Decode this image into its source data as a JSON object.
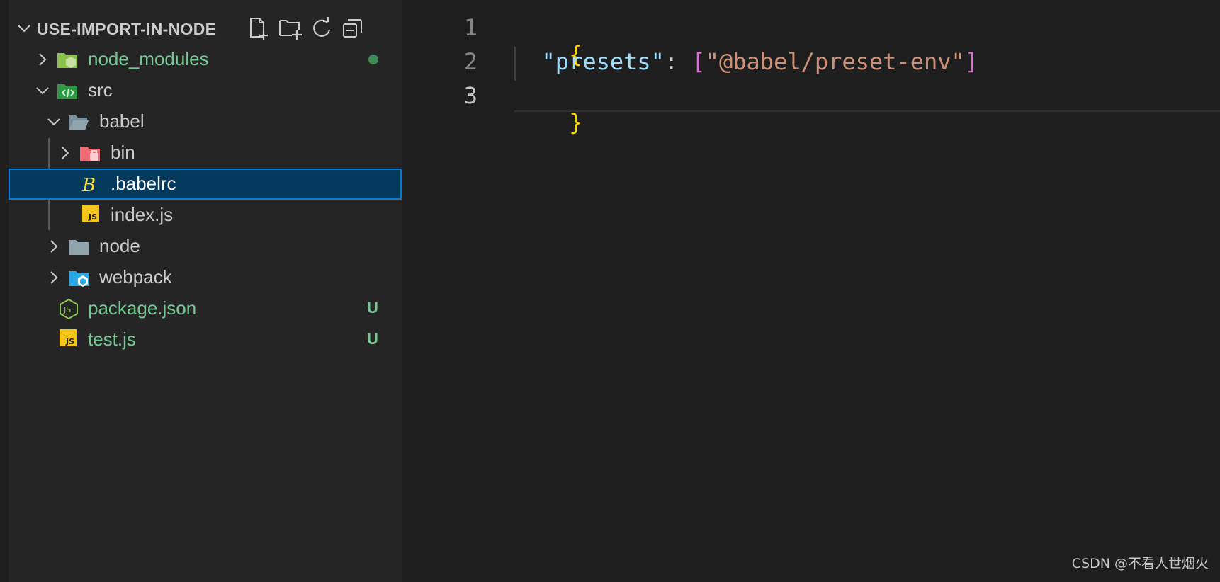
{
  "explorer": {
    "title": "USE-IMPORT-IN-NODE",
    "actions": [
      {
        "name": "new-file",
        "icon": "new-file-icon"
      },
      {
        "name": "new-folder",
        "icon": "new-folder-icon"
      },
      {
        "name": "refresh",
        "icon": "refresh-icon"
      },
      {
        "name": "collapse-all",
        "icon": "collapse-all-icon"
      }
    ],
    "tree": {
      "node_modules": {
        "label": "node_modules",
        "icon": "node-modules-folder-icon"
      },
      "src": {
        "label": "src",
        "icon": "src-folder-icon"
      },
      "babel": {
        "label": "babel",
        "icon": "folder-open-icon"
      },
      "bin": {
        "label": "bin",
        "icon": "bin-folder-icon"
      },
      "babelrc": {
        "label": ".babelrc",
        "icon": "babel-icon"
      },
      "index_js": {
        "label": "index.js",
        "icon": "js-file-icon"
      },
      "node": {
        "label": "node",
        "icon": "folder-icon"
      },
      "webpack": {
        "label": "webpack",
        "icon": "webpack-folder-icon"
      },
      "package_json": {
        "label": "package.json",
        "icon": "node-js-icon",
        "status": "U"
      },
      "test_js": {
        "label": "test.js",
        "icon": "js-file-icon",
        "status": "U"
      }
    }
  },
  "editor": {
    "line_numbers": [
      "1",
      "2",
      "3"
    ],
    "line1": {
      "brace": "{"
    },
    "line2": {
      "key": "\"presets\"",
      "colon": ": ",
      "open": "[",
      "value": "\"@babel/preset-env\"",
      "close": "]"
    },
    "line3": {
      "brace": "}"
    }
  },
  "watermark": "CSDN @不看人世烟火",
  "colors": {
    "selection_bg": "#04395e",
    "selection_border": "#0a7ad6",
    "git_untracked": "#73c991",
    "brace": "#ffd700",
    "json_key": "#9cdcfe",
    "json_string": "#ce9178",
    "bracket": "#da70d6"
  }
}
